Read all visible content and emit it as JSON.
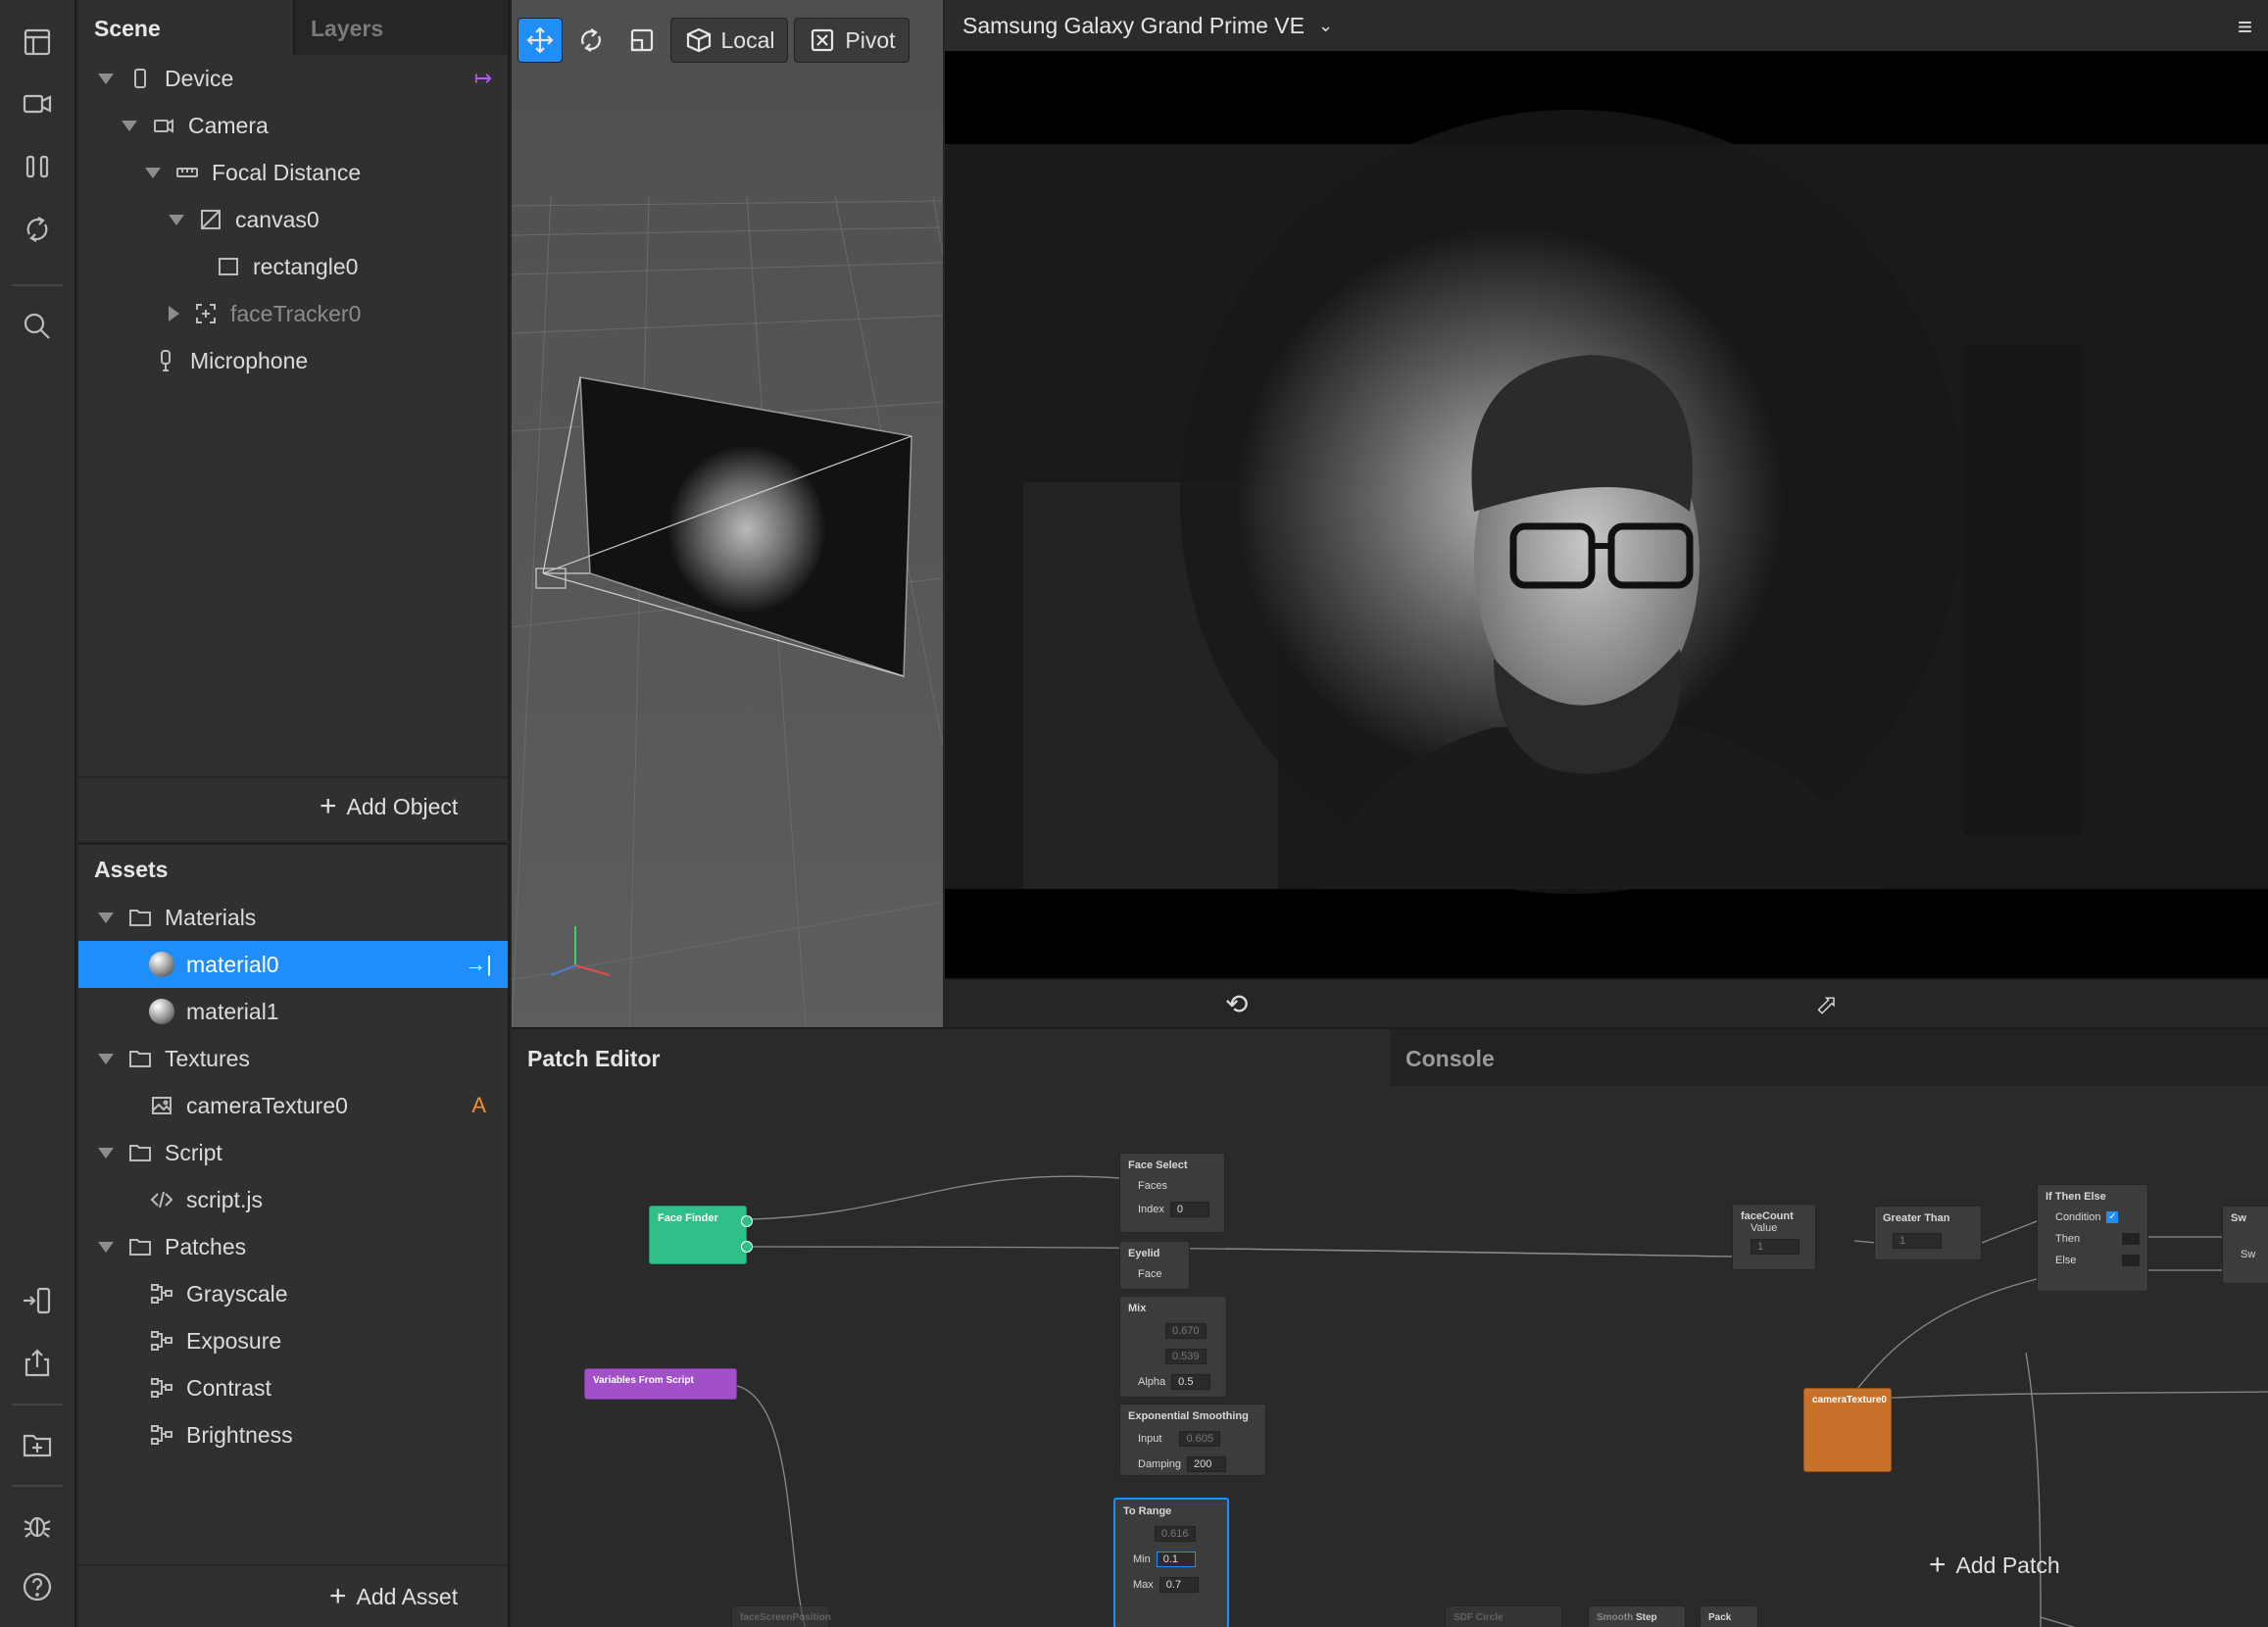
{
  "scene_panel": {
    "tabs": [
      "Scene",
      "Layers"
    ],
    "tree": [
      {
        "label": "Device",
        "icon": "phone-icon"
      },
      {
        "label": "Camera",
        "icon": "camera-icon"
      },
      {
        "label": "Focal Distance",
        "icon": "ruler-icon"
      },
      {
        "label": "canvas0",
        "icon": "canvas-icon"
      },
      {
        "label": "rectangle0",
        "icon": "rectangle-icon"
      },
      {
        "label": "faceTracker0",
        "icon": "face-tracker-icon"
      },
      {
        "label": "Microphone",
        "icon": "microphone-icon"
      }
    ],
    "add_object": "Add Object"
  },
  "assets_panel": {
    "title": "Assets",
    "tree": [
      {
        "label": "Materials",
        "icon": "folder-icon"
      },
      {
        "label": "material0",
        "icon": "sphere-icon"
      },
      {
        "label": "material1",
        "icon": "sphere-icon"
      },
      {
        "label": "Textures",
        "icon": "folder-icon"
      },
      {
        "label": "cameraTexture0",
        "icon": "image-icon",
        "badge": "A"
      },
      {
        "label": "Script",
        "icon": "folder-icon"
      },
      {
        "label": "script.js",
        "icon": "code-icon"
      },
      {
        "label": "Patches",
        "icon": "folder-icon"
      },
      {
        "label": "Grayscale",
        "icon": "patch-icon"
      },
      {
        "label": "Exposure",
        "icon": "patch-icon"
      },
      {
        "label": "Contrast",
        "icon": "patch-icon"
      },
      {
        "label": "Brightness",
        "icon": "patch-icon"
      }
    ],
    "add_asset": "Add Asset"
  },
  "viewport": {
    "local_label": "Local",
    "pivot_label": "Pivot"
  },
  "simulator": {
    "device": "Samsung Galaxy Grand Prime VE"
  },
  "patch_editor": {
    "tabs": [
      "Patch Editor",
      "Console"
    ],
    "add_patch": "Add Patch",
    "nodes": {
      "face_finder": {
        "title": "Face Finder"
      },
      "variables": {
        "title": "Variables From Script"
      },
      "face_select": {
        "title": "Face Select",
        "faces": "Faces",
        "index_label": "Index",
        "index_value": "0"
      },
      "eyelid": {
        "title": "Eyelid",
        "face": "Face"
      },
      "mix": {
        "title": "Mix",
        "v1": "0.670",
        "v2": "0.539",
        "alpha_label": "Alpha",
        "alpha_value": "0.5"
      },
      "exp_smoothing": {
        "title": "Exponential Smoothing",
        "input_label": "Input",
        "input_value": "0.605",
        "damping_label": "Damping",
        "damping_value": "200"
      },
      "to_range": {
        "title": "To Range",
        "v1": "0.616",
        "min_label": "Min",
        "min_value": "0.1",
        "max_label": "Max",
        "max_value": "0.7"
      },
      "face_count": {
        "title": "faceCount",
        "sub": "Value",
        "value": "1"
      },
      "greater_than": {
        "title": "Greater Than",
        "value": "1"
      },
      "if_then_else": {
        "title": "If Then Else",
        "condition": "Condition",
        "then": "Then",
        "else": "Else"
      },
      "switch": {
        "title": "Sw",
        "sub": "Sw"
      },
      "camera_texture": {
        "title": "cameraTexture0"
      },
      "bottom": [
        "faceScreenPosition",
        "SDF Circle",
        "Smooth",
        "Step",
        "Pack"
      ]
    }
  },
  "colors": {
    "accent": "#1f8efa",
    "face_finder": "#2fc08a",
    "variables": "#a150c9",
    "camera_texture": "#c8712a",
    "badge": "#f0902a"
  }
}
